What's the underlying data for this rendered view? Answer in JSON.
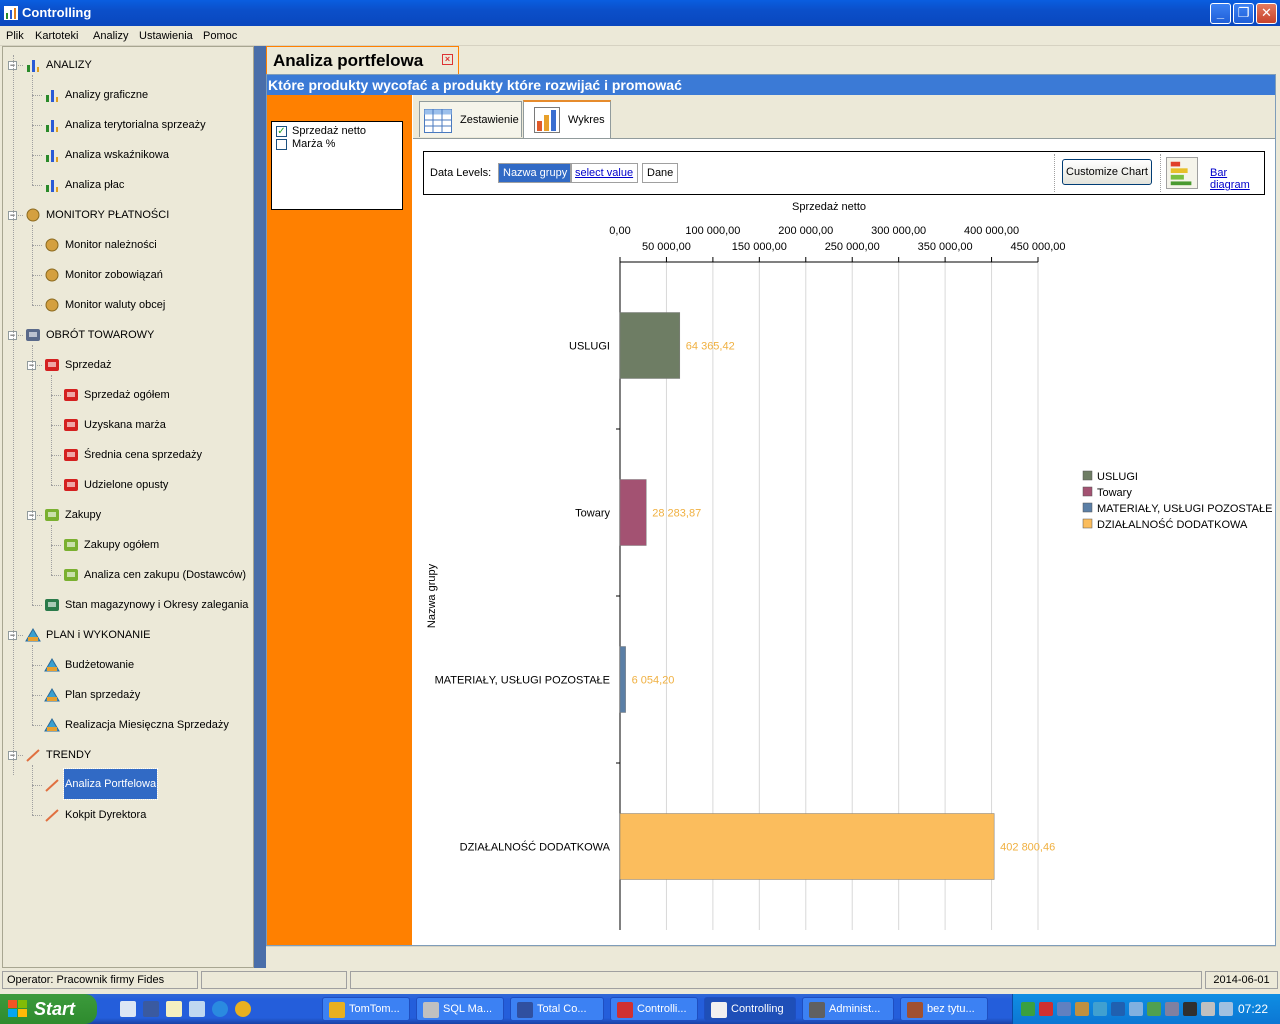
{
  "window": {
    "title": "Controlling"
  },
  "menu": [
    "Plik",
    "Kartoteki",
    "Analizy",
    "Ustawienia",
    "Pomoc"
  ],
  "tree": [
    {
      "label": "ANALIZY",
      "level": 0,
      "icon": "chart-icon",
      "expander": "−"
    },
    {
      "label": "Analizy graficzne",
      "level": 1,
      "icon": "chart-icon"
    },
    {
      "label": "Analiza terytorialna sprzeaży",
      "level": 1,
      "icon": "chart-icon"
    },
    {
      "label": "Analiza wskaźnikowa",
      "level": 1,
      "icon": "chart-icon"
    },
    {
      "label": "Analiza płac",
      "level": 1,
      "icon": "chart-icon"
    },
    {
      "label": "MONITORY PŁATNOŚCI",
      "level": 0,
      "icon": "coin-icon",
      "expander": "−"
    },
    {
      "label": "Monitor należności",
      "level": 1,
      "icon": "coin-icon"
    },
    {
      "label": "Monitor zobowiązań",
      "level": 1,
      "icon": "coin-icon"
    },
    {
      "label": "Monitor waluty obcej",
      "level": 1,
      "icon": "coin-icon"
    },
    {
      "label": "OBRÓT TOWAROWY",
      "level": 0,
      "icon": "cart-icon",
      "expander": "−"
    },
    {
      "label": "Sprzedaż",
      "level": 1,
      "icon": "red-cart-icon",
      "expander": "−"
    },
    {
      "label": "Sprzedaż ogółem",
      "level": 2,
      "icon": "red-cart-icon"
    },
    {
      "label": "Uzyskana marża",
      "level": 2,
      "icon": "red-cart-icon"
    },
    {
      "label": "Średnia cena sprzedaży",
      "level": 2,
      "icon": "red-cart-icon"
    },
    {
      "label": "Udzielone opusty",
      "level": 2,
      "icon": "red-cart-icon"
    },
    {
      "label": "Zakupy",
      "level": 1,
      "icon": "green-cart-icon",
      "expander": "−"
    },
    {
      "label": "Zakupy ogółem",
      "level": 2,
      "icon": "green-cart-icon"
    },
    {
      "label": "Analiza cen zakupu (Dostawców)",
      "level": 2,
      "icon": "green-cart-icon"
    },
    {
      "label": "Stan magazynowy i Okresy zalegania",
      "level": 1,
      "icon": "basket-icon"
    },
    {
      "label": "PLAN i WYKONANIE",
      "level": 0,
      "icon": "pyramid-icon",
      "expander": "−"
    },
    {
      "label": "Budżetowanie",
      "level": 1,
      "icon": "pyramid-icon"
    },
    {
      "label": "Plan sprzedaży",
      "level": 1,
      "icon": "pyramid-icon"
    },
    {
      "label": "Realizacja Miesięczna Sprzedaży",
      "level": 1,
      "icon": "pyramid-icon"
    },
    {
      "label": "TRENDY",
      "level": 0,
      "icon": "trend-icon",
      "expander": "−"
    },
    {
      "label": "Analiza Portfelowa",
      "level": 1,
      "icon": "trend-icon",
      "selected": true
    },
    {
      "label": "Kokpit Dyrektora",
      "level": 1,
      "icon": "trend-icon"
    }
  ],
  "document_tab": {
    "title": "Analiza portfelowa"
  },
  "header": {
    "text": "Które produkty wycofać a produkty które rozwijać i promować"
  },
  "checks": [
    {
      "label": "Sprzedaż  netto",
      "checked": true
    },
    {
      "label": "Marża %",
      "checked": false
    }
  ],
  "subtabs": [
    {
      "label": "Zestawienie",
      "icon": "table-icon"
    },
    {
      "label": "Wykres",
      "icon": "bar-chart-icon",
      "active": true
    }
  ],
  "data_levels": {
    "label": "Data Levels:",
    "level1": "Nazwa grupy",
    "level2": "select value",
    "level3": "Dane",
    "customize": "Customize Chart",
    "chart_type_link": "Bar diagram"
  },
  "chart_data": {
    "type": "bar",
    "orientation": "horizontal",
    "title": "Sprzedaż  netto",
    "xlabel": "Sprzedaż  netto",
    "ylabel": "Nazwa grupy",
    "xlim": [
      0,
      450000
    ],
    "x_ticks_top": [
      "0,00",
      "100 000,00",
      "200 000,00",
      "300 000,00",
      "400 000,00"
    ],
    "x_ticks_bottom": [
      "50 000,00",
      "150 000,00",
      "250 000,00",
      "350 000,00",
      "450 000,00"
    ],
    "categories": [
      "USLUGI",
      "Towary",
      "MATERIAŁY, USŁUGI POZOSTAŁE",
      "DZIAŁALNOŚĆ DODATKOWA"
    ],
    "values": [
      64365.42,
      28283.87,
      6054.2,
      402800.46
    ],
    "value_labels": [
      "64 365,42",
      "28 283,87",
      "6 054,20",
      "402 800,46"
    ],
    "colors": [
      "#6e7d64",
      "#a35272",
      "#5b7fa6",
      "#fbbd5d"
    ],
    "legend": [
      "USLUGI",
      "Towary",
      "MATERIAŁY, USŁUGI POZOSTAŁE",
      "DZIAŁALNOŚĆ DODATKOWA"
    ],
    "legend_position": "right",
    "grid": true
  },
  "status": {
    "operator": "Operator: Pracownik firmy Fides",
    "date": "2014-06-01"
  },
  "taskbar": {
    "start": "Start",
    "tasks": [
      "TomTom...",
      "SQL Ma...",
      "Total Co...",
      "Controlli...",
      "Controlling",
      "Administ...",
      "bez tytu..."
    ],
    "active_task": 4,
    "clock": "07:22"
  }
}
